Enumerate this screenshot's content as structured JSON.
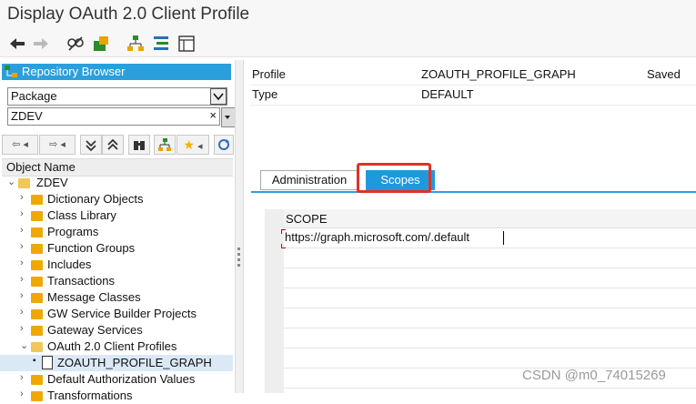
{
  "window": {
    "title": "Display OAuth 2.0 Client Profile"
  },
  "toolbar": {
    "icons": [
      "back-arrow-icon",
      "forward-arrow-icon",
      "display-change-icon",
      "object-activate-icon",
      "hierarchy-icon",
      "where-used-icon",
      "layout-icon"
    ]
  },
  "repository_browser": {
    "title": "Repository Browser",
    "object_type": "Package",
    "object_value": "ZDEV",
    "column_header": "Object Name",
    "tree": [
      {
        "label": "ZDEV",
        "level": 0,
        "expanded": true,
        "icon": "folder-open-icon"
      },
      {
        "label": "Dictionary Objects",
        "level": 1,
        "expanded": false,
        "icon": "folder-icon"
      },
      {
        "label": "Class Library",
        "level": 1,
        "expanded": false,
        "icon": "folder-icon"
      },
      {
        "label": "Programs",
        "level": 1,
        "expanded": false,
        "icon": "folder-icon"
      },
      {
        "label": "Function Groups",
        "level": 1,
        "expanded": false,
        "icon": "folder-icon"
      },
      {
        "label": "Includes",
        "level": 1,
        "expanded": false,
        "icon": "folder-icon"
      },
      {
        "label": "Transactions",
        "level": 1,
        "expanded": false,
        "icon": "folder-icon"
      },
      {
        "label": "Message Classes",
        "level": 1,
        "expanded": false,
        "icon": "folder-icon"
      },
      {
        "label": "GW Service Builder Projects",
        "level": 1,
        "expanded": false,
        "icon": "folder-icon"
      },
      {
        "label": "Gateway Services",
        "level": 1,
        "expanded": false,
        "icon": "folder-icon"
      },
      {
        "label": "OAuth 2.0 Client Profiles",
        "level": 1,
        "expanded": true,
        "icon": "folder-open-icon"
      },
      {
        "label": "ZOAUTH_PROFILE_GRAPH",
        "level": 2,
        "selected": true,
        "icon": "document-icon"
      },
      {
        "label": "Default Authorization Values",
        "level": 1,
        "expanded": false,
        "icon": "folder-icon"
      },
      {
        "label": "Transformations",
        "level": 1,
        "expanded": false,
        "icon": "folder-icon"
      }
    ]
  },
  "profile": {
    "profile_label": "Profile",
    "profile_value": "ZOAUTH_PROFILE_GRAPH",
    "status": "Saved",
    "type_label": "Type",
    "type_value": "DEFAULT"
  },
  "tabs": [
    {
      "label": "Administration",
      "active": false
    },
    {
      "label": "Scopes",
      "active": true
    }
  ],
  "scopes_table": {
    "column": "SCOPE",
    "rows": [
      "https://graph.microsoft.com/.default",
      "",
      "",
      "",
      "",
      "",
      "",
      ""
    ]
  },
  "watermark": "CSDN @m0_74015269",
  "colors": {
    "accent": "#2b9fdc",
    "highlight": "#e0302a",
    "folder": "#f0a800"
  }
}
